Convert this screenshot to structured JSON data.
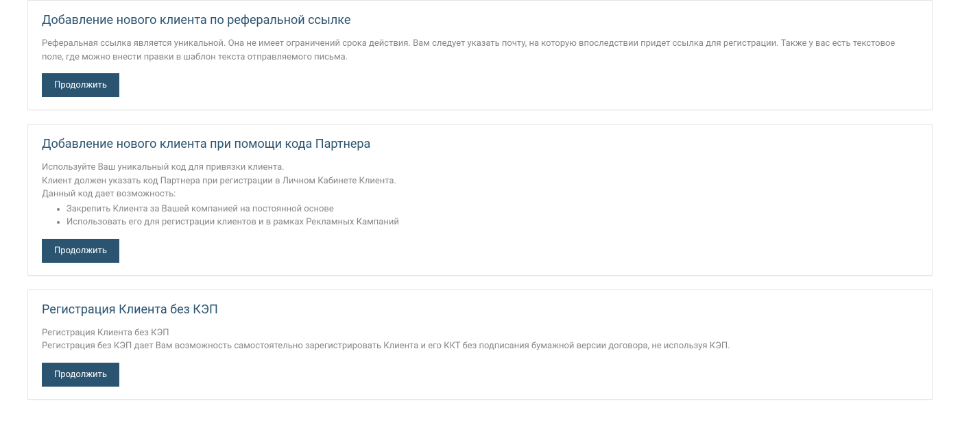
{
  "cards": [
    {
      "title": "Добавление нового клиента по реферальной ссылке",
      "description": "Реферальная ссылка является уникальной. Она не имеет ограничений срока действия. Вам следует указать почту, на которую впоследствии придет ссылка для регистрации. Также у вас есть текстовое поле, где можно внести правки в шаблон текста отправляемого письма.",
      "button_label": "Продолжить"
    },
    {
      "title": "Добавление нового клиента при помощи кода Партнера",
      "line1": "Используйте Ваш уникальный код для привязки клиента.",
      "line2": "Клиент должен указать код Партнера при регистрации в Личном Кабинете Клиента.",
      "line3": "Данный код дает возможность:",
      "bullets": [
        "Закрепить Клиента за Вашей компанией на постоянной основе",
        "Использовать его для регистрации клиентов и в рамках Рекламных Кампаний"
      ],
      "button_label": "Продолжить"
    },
    {
      "title": "Регистрация Клиента без КЭП",
      "line1": "Регистрация Клиента без КЭП",
      "line2": "Регистрация без КЭП дает Вам возможность самостоятельно зарегистрировать Клиента и его ККТ без подписания бумажной версии договора, не используя КЭП.",
      "button_label": "Продолжить"
    }
  ]
}
